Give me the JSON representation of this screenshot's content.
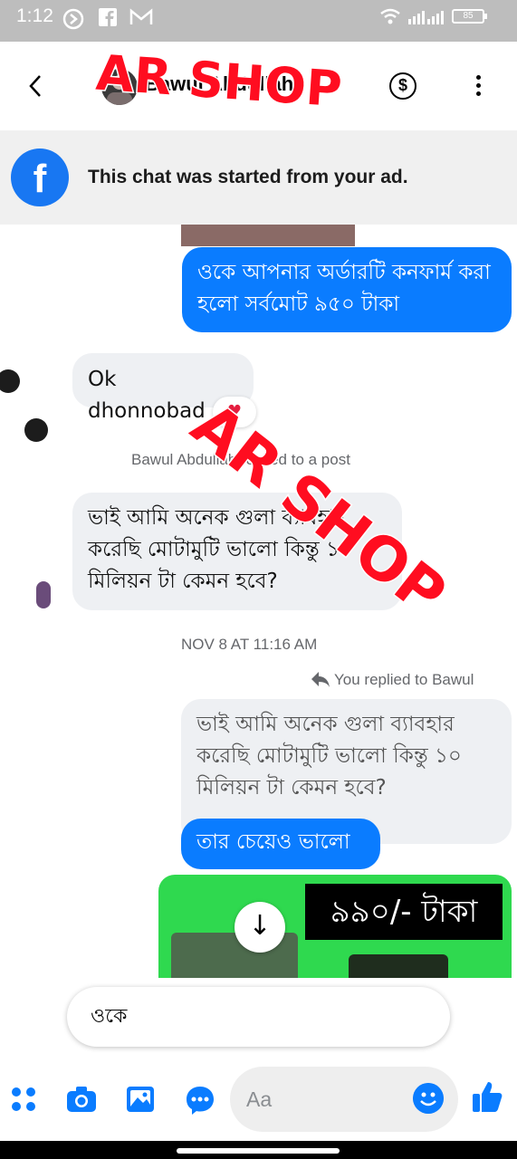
{
  "status_bar": {
    "time": "1:12",
    "battery": "85"
  },
  "header": {
    "contact_name": "Bawul Abdullah",
    "dollar_symbol": "$"
  },
  "ad_banner": {
    "text": "This chat was started from your ad."
  },
  "watermark": {
    "text_1": "AR SHOP",
    "text_2": "AR SHOP"
  },
  "messages": {
    "m1": "ওকে আপনার অর্ডারটি কনফার্ম করা হলো সর্বমোট ৯৫০ টাকা",
    "m2": "Ok dhonnobad",
    "reply_label": "Bawul Abdullah replied to a post",
    "m3": "ভাই আমি অনেক গুলা ব্যাবহার করেছি মোটামুটি ভালো কিন্তু ১০ মিলিয়ন টা কেমন হবে?",
    "date": "NOV 8 AT 11:16 AM",
    "you_replied": "You replied to Bawul",
    "quoted": "ভাই আমি অনেক গুলা ব্যাবহার করেছি মোটামুটি ভালো কিন্তু ১০ মিলিয়ন টা কেমন হবে?",
    "m4": "তার চেয়েও ভালো",
    "price": "৯৯০/- টাকা"
  },
  "quick_reply": "ওকে",
  "composer": {
    "placeholder": "Aa"
  },
  "colors": {
    "messenger_blue": "#0a7cff",
    "watermark_red": "#ff0d20"
  },
  "icons": [
    "back-arrow-icon",
    "dollar-icon",
    "more-vert-icon",
    "facebook-icon",
    "apps-icon",
    "camera-icon",
    "gallery-icon",
    "chat-bubble-icon",
    "emoji-icon",
    "thumbs-up-icon",
    "download-icon",
    "reply-icon",
    "heart-icon"
  ]
}
